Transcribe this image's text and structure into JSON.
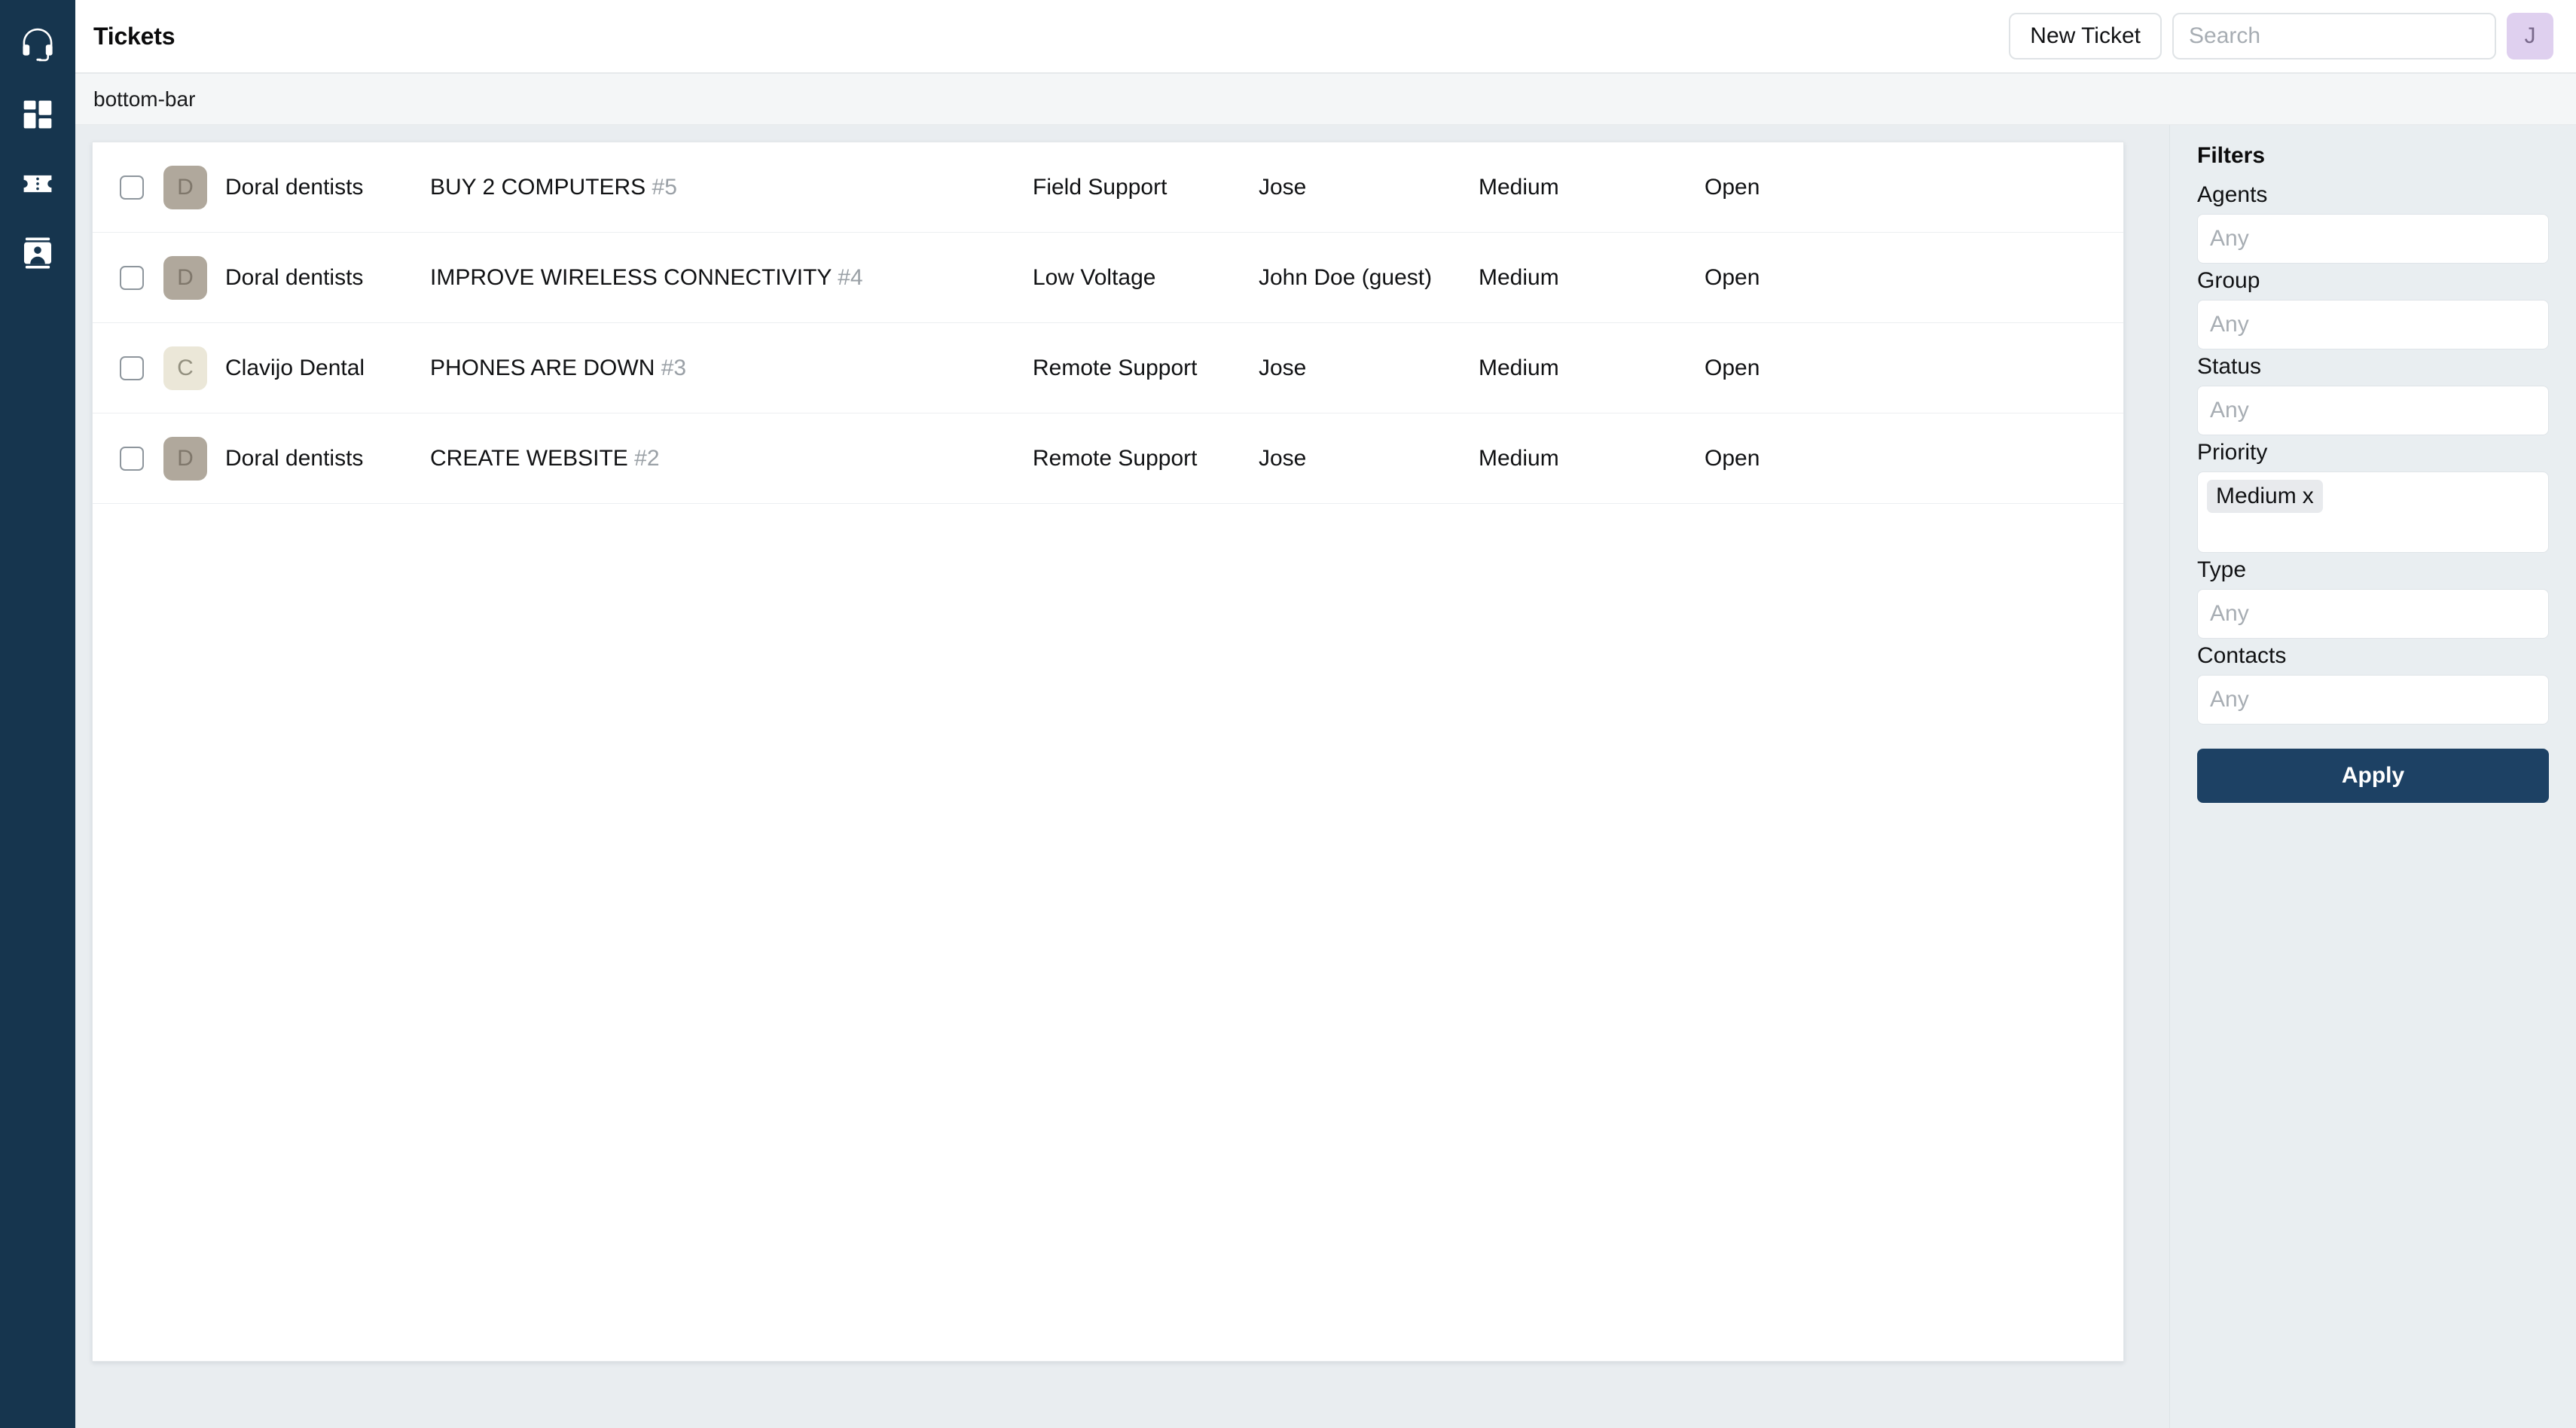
{
  "sidebar": {
    "brand_icon": "headset-icon",
    "items": [
      {
        "icon": "headset-icon",
        "name": "brand-headset"
      },
      {
        "icon": "dashboard-grid-icon",
        "name": "dashboard"
      },
      {
        "icon": "ticket-icon",
        "name": "tickets"
      },
      {
        "icon": "contact-card-icon",
        "name": "contacts"
      }
    ]
  },
  "header": {
    "title": "Tickets",
    "new_ticket_label": "New Ticket",
    "search": {
      "value": "",
      "placeholder": "Search"
    },
    "avatar": {
      "initial": "J",
      "bg": "#dfd0ef",
      "fg": "#7a6a8c"
    }
  },
  "subbar": {
    "label": "bottom-bar"
  },
  "table": {
    "columns": [
      "select",
      "company",
      "subject",
      "group",
      "agent",
      "priority",
      "status"
    ],
    "rows": [
      {
        "checked": false,
        "avatar": {
          "initial": "D",
          "bg": "#b0a89c",
          "fg": "#7f776b"
        },
        "company": "Doral dentists",
        "subject": "BUY 2 COMPUTERS",
        "ticket_number": "#5",
        "group": "Field Support",
        "agent": "Jose",
        "priority": "Medium",
        "status": "Open"
      },
      {
        "checked": false,
        "avatar": {
          "initial": "D",
          "bg": "#b0a89c",
          "fg": "#7f776b"
        },
        "company": "Doral dentists",
        "subject": "IMPROVE WIRELESS CONNECTIVITY",
        "ticket_number": "#4",
        "group": "Low Voltage",
        "agent": "John Doe (guest)",
        "priority": "Medium",
        "status": "Open"
      },
      {
        "checked": false,
        "avatar": {
          "initial": "C",
          "bg": "#ebe7d8",
          "fg": "#93907f"
        },
        "company": "Clavijo Dental",
        "subject": "PHONES ARE DOWN",
        "ticket_number": "#3",
        "group": "Remote Support",
        "agent": "Jose",
        "priority": "Medium",
        "status": "Open"
      },
      {
        "checked": false,
        "avatar": {
          "initial": "D",
          "bg": "#b0a89c",
          "fg": "#7f776b"
        },
        "company": "Doral dentists",
        "subject": "CREATE WEBSITE",
        "ticket_number": "#2",
        "group": "Remote Support",
        "agent": "Jose",
        "priority": "Medium",
        "status": "Open"
      }
    ]
  },
  "filters": {
    "title": "Filters",
    "fields": [
      {
        "label": "Agents",
        "type": "input",
        "value": "",
        "placeholder": "Any"
      },
      {
        "label": "Group",
        "type": "input",
        "value": "",
        "placeholder": "Any"
      },
      {
        "label": "Status",
        "type": "input",
        "value": "",
        "placeholder": "Any"
      },
      {
        "label": "Priority",
        "type": "tokenbox",
        "tokens": [
          {
            "label": "Medium",
            "remove": "x"
          }
        ]
      },
      {
        "label": "Type",
        "type": "input",
        "value": "",
        "placeholder": "Any"
      },
      {
        "label": "Contacts",
        "type": "input",
        "value": "",
        "placeholder": "Any"
      }
    ],
    "apply_label": "Apply",
    "apply_bg": "#1d4164"
  },
  "theme": {
    "sidebar_bg": "#16354e",
    "page_bg": "#e9edf0",
    "panel_bg": "#e9eef1",
    "card_bg": "#ffffff",
    "accent": "#1d4164"
  }
}
